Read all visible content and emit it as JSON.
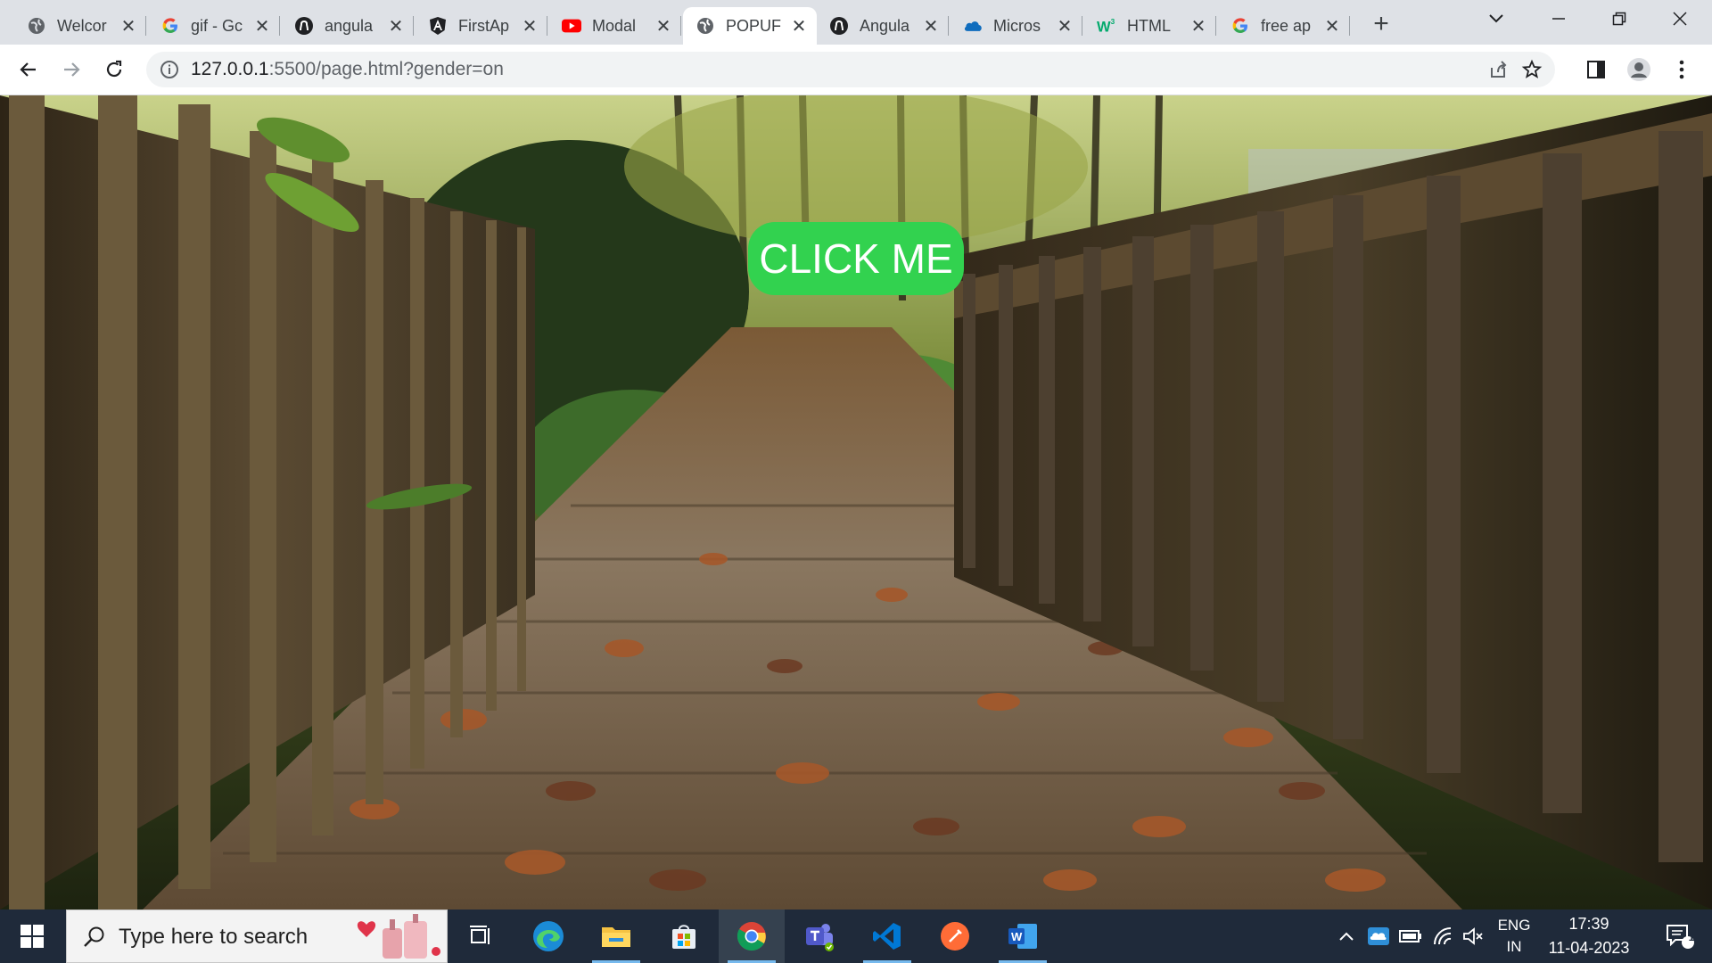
{
  "tabs": [
    {
      "title": "Welcor",
      "icon": "globe-icon"
    },
    {
      "title": "gif - Gc",
      "icon": "google-icon"
    },
    {
      "title": "angula",
      "icon": "github-icon"
    },
    {
      "title": "FirstAp",
      "icon": "angular-a-icon"
    },
    {
      "title": "Modal",
      "icon": "youtube-icon"
    },
    {
      "title": "POPUF",
      "icon": "globe-icon",
      "active": true
    },
    {
      "title": "Angula",
      "icon": "github-icon"
    },
    {
      "title": "Micros",
      "icon": "onedrive-cloud-icon"
    },
    {
      "title": "HTML",
      "icon": "w3schools-icon"
    },
    {
      "title": "free ap",
      "icon": "google-icon"
    }
  ],
  "address_bar": {
    "url_host": "127.0.0.1",
    "url_rest": ":5500/page.html?gender=on"
  },
  "page": {
    "button_label": "CLICK ME",
    "button_color": "#32d24f"
  },
  "taskbar": {
    "search_placeholder": "Type here to search",
    "language_top": "ENG",
    "language_bottom": "IN",
    "time": "17:39",
    "date": "11-04-2023",
    "notification_count": "1",
    "apps": [
      "task-view-icon",
      "edge-icon",
      "file-explorer-icon",
      "microsoft-store-icon",
      "chrome-icon",
      "teams-icon",
      "vscode-icon",
      "postman-icon",
      "word-icon"
    ]
  }
}
